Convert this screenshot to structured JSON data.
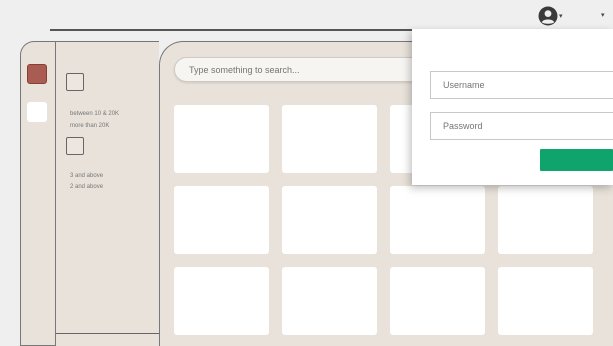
{
  "header": {
    "user_icon": "user-circle-icon",
    "caret_icon": "caret-down-icon"
  },
  "sidebar": {
    "swatches": [
      {
        "name": "red",
        "color": "#a85c52"
      },
      {
        "name": "white",
        "color": "#ffffff"
      }
    ]
  },
  "filters": {
    "price_options": [
      "between 10 & 20K",
      "more than 20K"
    ],
    "rating_options": [
      "3 and above",
      "2 and above"
    ]
  },
  "main": {
    "search_placeholder": "Type something to search..."
  },
  "login": {
    "username_placeholder": "Username",
    "password_placeholder": "Password",
    "button_color": "#0fa46c"
  },
  "colors": {
    "panel_bg": "#e8e2da",
    "page_bg": "#efefef",
    "accent_green": "#0fa46c"
  }
}
